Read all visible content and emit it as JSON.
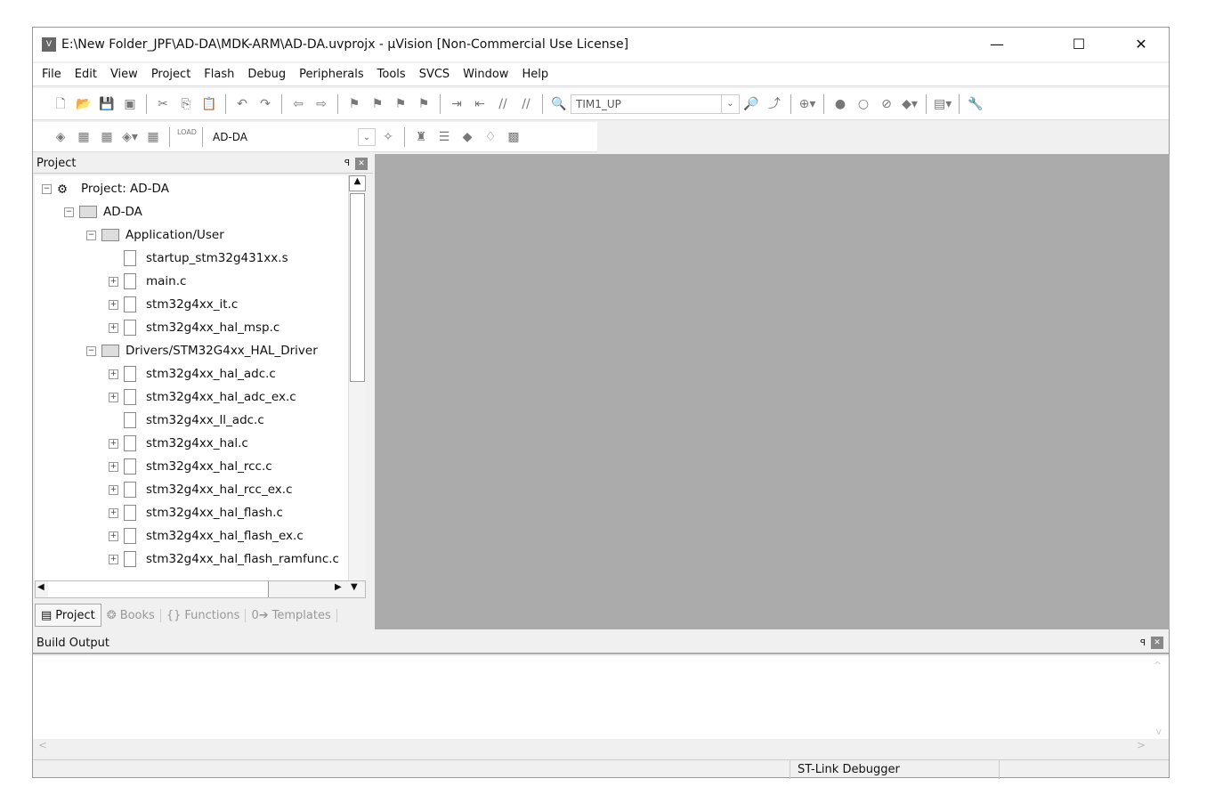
{
  "window": {
    "title": "E:\\New Folder_JPF\\AD-DA\\MDK-ARM\\AD-DA.uvprojx - µVision  [Non-Commercial Use License]",
    "app_icon": "uvision-icon",
    "minimize": "—",
    "maximize": "☐",
    "close": "✕"
  },
  "menu": [
    "File",
    "Edit",
    "View",
    "Project",
    "Flash",
    "Debug",
    "Peripherals",
    "Tools",
    "SVCS",
    "Window",
    "Help"
  ],
  "toolbar": {
    "find_combo": "TIM1_UP",
    "target_combo": "AD-DA",
    "load_label": "LOAD"
  },
  "project_panel": {
    "title": "Project",
    "pin": "ꟼ",
    "close": "✕",
    "tree": [
      {
        "label": "Project: AD-DA",
        "level": 0,
        "type": "project",
        "expander": "−"
      },
      {
        "label": "AD-DA",
        "level": 1,
        "type": "target",
        "expander": "−"
      },
      {
        "label": "Application/User",
        "level": 2,
        "type": "folder",
        "expander": "−"
      },
      {
        "label": "startup_stm32g431xx.s",
        "level": 3,
        "type": "file",
        "expander": ""
      },
      {
        "label": "main.c",
        "level": 3,
        "type": "file",
        "expander": "+"
      },
      {
        "label": "stm32g4xx_it.c",
        "level": 3,
        "type": "file",
        "expander": "+"
      },
      {
        "label": "stm32g4xx_hal_msp.c",
        "level": 3,
        "type": "file",
        "expander": "+"
      },
      {
        "label": "Drivers/STM32G4xx_HAL_Driver",
        "level": 2,
        "type": "folder",
        "expander": "−"
      },
      {
        "label": "stm32g4xx_hal_adc.c",
        "level": 3,
        "type": "file",
        "expander": "+"
      },
      {
        "label": "stm32g4xx_hal_adc_ex.c",
        "level": 3,
        "type": "file",
        "expander": "+"
      },
      {
        "label": "stm32g4xx_ll_adc.c",
        "level": 3,
        "type": "file",
        "expander": ""
      },
      {
        "label": "stm32g4xx_hal.c",
        "level": 3,
        "type": "file",
        "expander": "+"
      },
      {
        "label": "stm32g4xx_hal_rcc.c",
        "level": 3,
        "type": "file",
        "expander": "+"
      },
      {
        "label": "stm32g4xx_hal_rcc_ex.c",
        "level": 3,
        "type": "file",
        "expander": "+"
      },
      {
        "label": "stm32g4xx_hal_flash.c",
        "level": 3,
        "type": "file",
        "expander": "+"
      },
      {
        "label": "stm32g4xx_hal_flash_ex.c",
        "level": 3,
        "type": "file",
        "expander": "+"
      },
      {
        "label": "stm32g4xx_hal_flash_ramfunc.c",
        "level": 3,
        "type": "file",
        "expander": "+"
      }
    ],
    "tabs": [
      {
        "label": "Project",
        "icon": "▤"
      },
      {
        "label": "Books",
        "icon": "❂"
      },
      {
        "label": "Functions",
        "icon": "{}"
      },
      {
        "label": "Templates",
        "icon": "0➔"
      }
    ]
  },
  "build_output": {
    "title": "Build Output",
    "pin": "ꟼ",
    "close": "✕"
  },
  "status": {
    "debugger": "ST-Link Debugger"
  }
}
